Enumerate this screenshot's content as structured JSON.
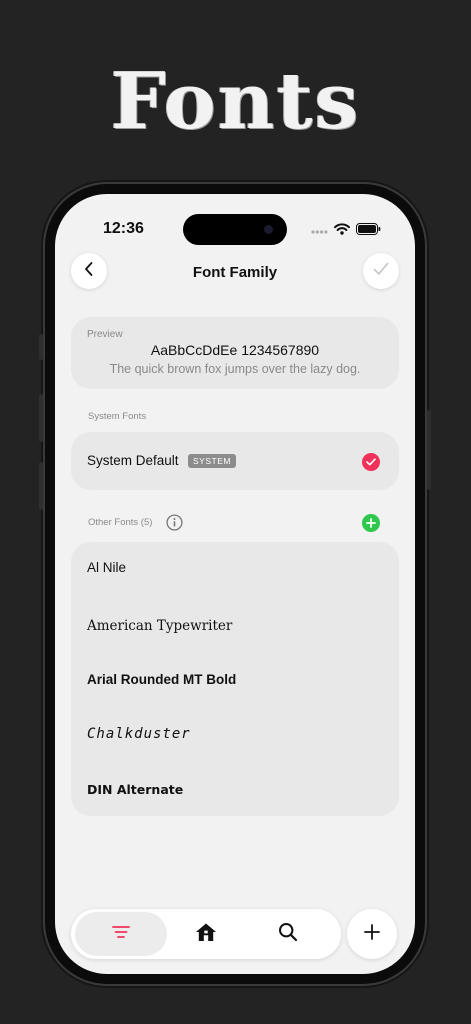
{
  "promo": {
    "title": "Fonts"
  },
  "status_bar": {
    "time": "12:36"
  },
  "nav": {
    "title": "Font Family"
  },
  "preview": {
    "label": "Preview",
    "sample": "AaBbCcDdEe 1234567890",
    "sentence": "The quick brown fox jumps over the lazy dog."
  },
  "system_fonts": {
    "section_label": "System Fonts",
    "default_label": "System Default",
    "badge": "SYSTEM",
    "selected": true
  },
  "other_fonts": {
    "section_label": "Other Fonts (5)",
    "items": [
      {
        "label": "Al Nile"
      },
      {
        "label": "American Typewriter"
      },
      {
        "label": "Arial Rounded MT Bold"
      },
      {
        "label": "Chalkduster"
      },
      {
        "label": "DIN Alternate"
      }
    ]
  },
  "tabbar": {
    "tabs": [
      {
        "icon": "list-icon",
        "active": true
      },
      {
        "icon": "home-icon",
        "active": false
      },
      {
        "icon": "search-icon",
        "active": false
      }
    ],
    "add_icon": "plus-icon"
  },
  "colors": {
    "accent": "#f0325a",
    "add_green": "#2ec84c",
    "background": "#232323",
    "screen": "#f2f2f2",
    "card": "#e8e8e8"
  }
}
